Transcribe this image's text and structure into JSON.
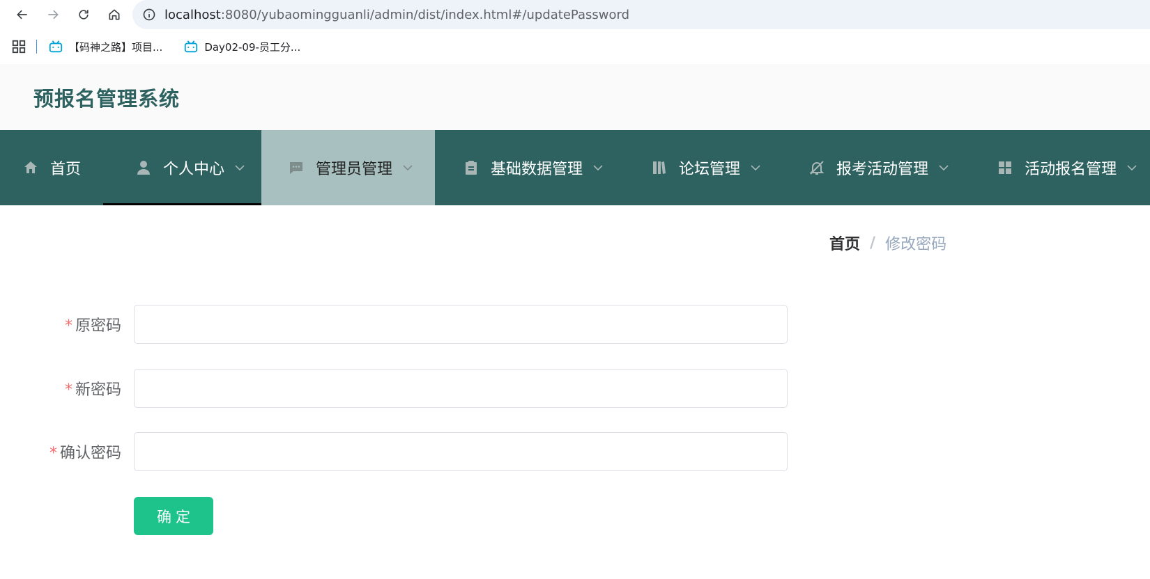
{
  "browser": {
    "url_host": "localhost",
    "url_path": ":8080/yubaomingguanli/admin/dist/index.html#/updatePassword",
    "bookmarks": [
      {
        "label": "【码神之路】项目..."
      },
      {
        "label": "Day02-09-员工分..."
      }
    ]
  },
  "app": {
    "title": "预报名管理系统"
  },
  "menu": {
    "items": [
      {
        "label": "首页",
        "icon": "home-icon"
      },
      {
        "label": "个人中心",
        "icon": "user-icon"
      },
      {
        "label": "管理员管理",
        "icon": "chat-icon"
      },
      {
        "label": "基础数据管理",
        "icon": "clipboard-icon"
      },
      {
        "label": "论坛管理",
        "icon": "books-icon"
      },
      {
        "label": "报考活动管理",
        "icon": "bell-off-icon"
      },
      {
        "label": "活动报名管理",
        "icon": "grid-icon"
      }
    ]
  },
  "breadcrumb": {
    "home": "首页",
    "separator": "/",
    "current": "修改密码"
  },
  "form": {
    "required_mark": "*",
    "old_password_label": "原密码",
    "new_password_label": "新密码",
    "confirm_password_label": "确认密码",
    "submit_label": "确定"
  },
  "colors": {
    "menu_bg": "#2d6260",
    "menu_active_bg": "#a8c0bf",
    "title": "#2d6260",
    "submit": "#1ec28b",
    "required": "#f56c6c"
  }
}
